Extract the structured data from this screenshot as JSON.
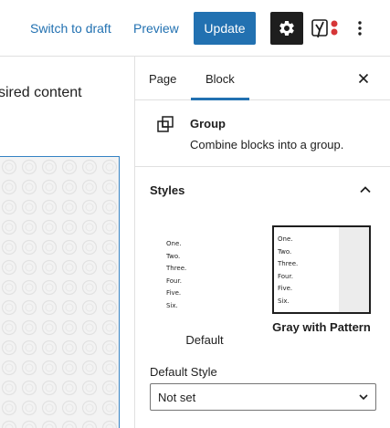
{
  "toolbar": {
    "switch_to_draft": "Switch to draft",
    "preview": "Preview",
    "update": "Update",
    "settings_icon": "gear-icon",
    "yoast_icon": "yoast-icon",
    "more_icon": "more-vertical-icon"
  },
  "canvas": {
    "text": "sired content"
  },
  "sidebar": {
    "tabs": [
      {
        "label": "Page",
        "active": false
      },
      {
        "label": "Block",
        "active": true
      }
    ],
    "close_icon": "close-icon",
    "block": {
      "icon": "group-icon",
      "title": "Group",
      "description": "Combine blocks into a group."
    },
    "styles": {
      "title": "Styles",
      "expanded": true,
      "options": [
        {
          "label": "Default",
          "preview_lines": [
            "One.",
            "Two.",
            "Three.",
            "Four.",
            "Five.",
            "Six."
          ],
          "selected": false
        },
        {
          "label": "Gray with Pattern",
          "preview_lines": [
            "One.",
            "Two.",
            "Three.",
            "Four.",
            "Five.",
            "Six."
          ],
          "selected": true
        }
      ]
    },
    "default_style": {
      "label": "Default Style",
      "value": "Not set"
    }
  },
  "colors": {
    "accent": "#2271b1",
    "dark": "#1e1e1e",
    "border": "#e0e0e0",
    "selection_outline": "#3582c4"
  }
}
